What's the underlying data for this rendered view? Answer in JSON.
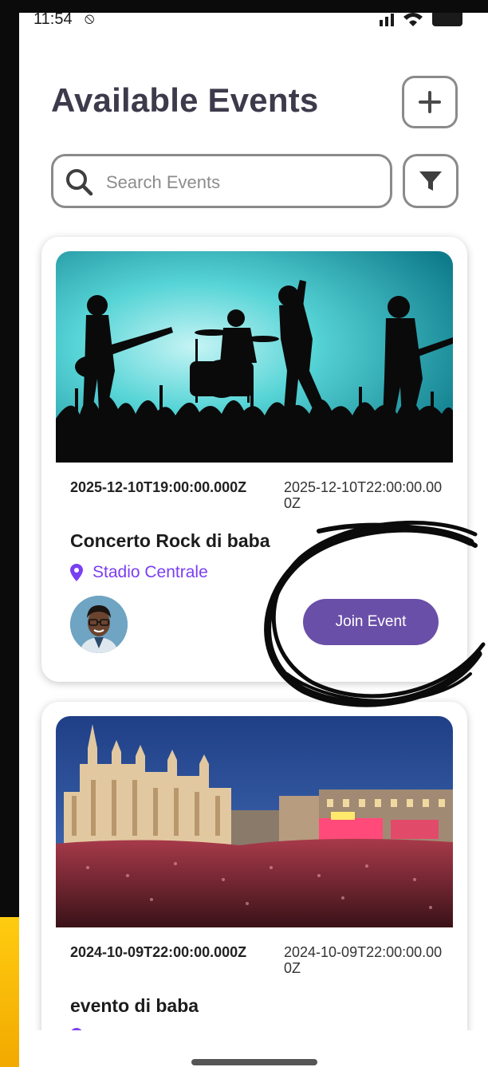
{
  "status_bar": {
    "time": "11:54",
    "alarm_icon": "alarm-off-icon",
    "signal_icon": "signal-icon",
    "wifi_icon": "wifi-icon",
    "battery_icon": "battery-icon"
  },
  "header": {
    "title": "Available Events",
    "add_icon": "plus-icon"
  },
  "search": {
    "placeholder": "Search Events",
    "search_icon": "search-icon",
    "filter_icon": "filter-icon"
  },
  "colors": {
    "accent": "#6a4fa8",
    "location": "#7b3ff2",
    "title": "#3d3a4b",
    "border": "#8a8a8a"
  },
  "events": [
    {
      "image": "rock-concert-silhouette-image",
      "start": "2025-12-10T19:00:00.000Z",
      "end": "2025-12-10T22:00:00.000Z",
      "name": "Concerto Rock di baba",
      "location": "Stadio Centrale",
      "avatar": "organizer-avatar",
      "join_label": "Join Event"
    },
    {
      "image": "milan-cathedral-crowd-image",
      "start": "2024-10-09T22:00:00.000Z",
      "end": "2024-10-09T22:00:00.000Z",
      "name": "evento di baba"
    }
  ]
}
